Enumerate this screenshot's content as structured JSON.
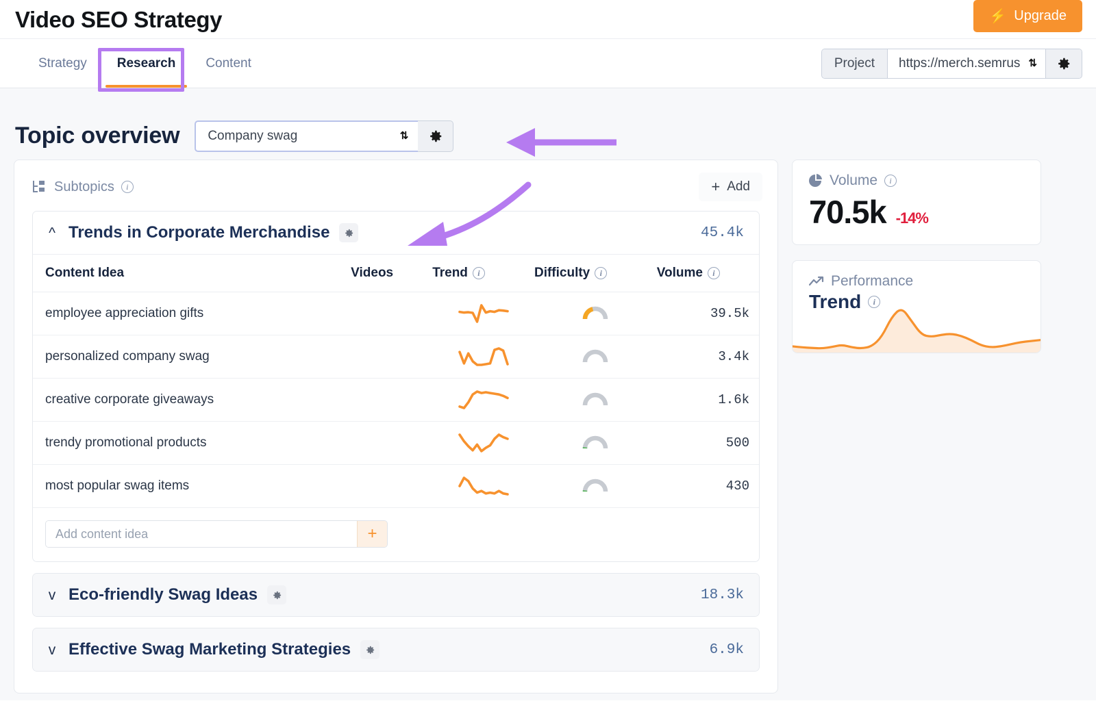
{
  "header": {
    "title": "Video SEO Strategy",
    "upgrade_label": "Upgrade",
    "bolt_icon": "lightning-bolt-icon"
  },
  "tabs": [
    {
      "label": "Strategy",
      "active": false
    },
    {
      "label": "Research",
      "active": true
    },
    {
      "label": "Content",
      "active": false
    }
  ],
  "project": {
    "label": "Project",
    "value": "https://merch.semrus",
    "gear_icon": "gear-icon"
  },
  "overview": {
    "title": "Topic overview",
    "topic_value": "Company swag",
    "gear_icon": "gear-icon"
  },
  "subtopics_panel": {
    "label": "Subtopics",
    "info_icon": "info-icon",
    "tree_icon": "hierarchy-icon",
    "add_label": "Add",
    "add_icon": "plus-icon"
  },
  "table": {
    "columns": [
      "Content Idea",
      "Videos",
      "Trend",
      "Difficulty",
      "Volume"
    ],
    "rows": [
      {
        "idea": "employee appreciation gifts",
        "videos": "",
        "volume": "39.5k",
        "difficulty": 42,
        "difficulty_color": "#f5a623",
        "trend": [
          50,
          48,
          49,
          47,
          20,
          70,
          48,
          52,
          50,
          55,
          54,
          52
        ]
      },
      {
        "idea": "personalized company swag",
        "videos": "",
        "volume": "3.4k",
        "difficulty": 2,
        "difficulty_color": "#c7cbd1",
        "trend": [
          62,
          30,
          58,
          36,
          26,
          26,
          28,
          30,
          68,
          72,
          66,
          28
        ]
      },
      {
        "idea": "creative corporate giveaways",
        "videos": "",
        "volume": "1.6k",
        "difficulty": 2,
        "difficulty_color": "#c7cbd1",
        "trend": [
          28,
          24,
          40,
          62,
          70,
          66,
          68,
          66,
          64,
          62,
          58,
          52
        ]
      },
      {
        "idea": "trendy promotional products",
        "videos": "",
        "volume": "500",
        "difficulty": 3,
        "difficulty_color": "#4caf50",
        "trend": [
          62,
          46,
          34,
          24,
          38,
          22,
          30,
          36,
          52,
          62,
          56,
          52
        ]
      },
      {
        "idea": "most popular swag items",
        "videos": "",
        "volume": "430",
        "difficulty": 3,
        "difficulty_color": "#4caf50",
        "trend": [
          46,
          66,
          58,
          40,
          30,
          34,
          28,
          30,
          28,
          34,
          28,
          26
        ]
      }
    ],
    "add_idea_placeholder": "Add content idea",
    "add_idea_value": "",
    "add_idea_button": "+"
  },
  "subtopic_groups": [
    {
      "title": "Trends in Corporate Merchandise",
      "volume": "45.4k",
      "expanded": true,
      "chevron": "^",
      "gear_icon": "gear-icon"
    },
    {
      "title": "Eco-friendly Swag Ideas",
      "volume": "18.3k",
      "expanded": false,
      "chevron": "v",
      "gear_icon": "gear-icon"
    },
    {
      "title": "Effective Swag Marketing Strategies",
      "volume": "6.9k",
      "expanded": false,
      "chevron": "v",
      "gear_icon": "gear-icon"
    }
  ],
  "sidebar": {
    "volume_card": {
      "label": "Volume",
      "icon": "pie-chart-icon",
      "info_icon": "info-icon",
      "value": "70.5k",
      "delta": "-14%",
      "delta_color": "#e01e3c"
    },
    "performance_card": {
      "label": "Performance",
      "icon": "trending-up-icon",
      "title": "Trend",
      "info_icon": "info-icon",
      "line_color": "#f7922e",
      "series": [
        22,
        20,
        19,
        18,
        21,
        25,
        20,
        18,
        22,
        40,
        78,
        96,
        70,
        44,
        40,
        44,
        46,
        42,
        34,
        24,
        20,
        22,
        26,
        30,
        32,
        34
      ]
    }
  },
  "annotations": {
    "color": "#b57bf0",
    "items": [
      {
        "name": "arrow-to-topic-selector",
        "type": "straight-arrow-left"
      },
      {
        "name": "arrow-to-subtopic-settings",
        "type": "curved-arrow-left"
      },
      {
        "name": "research-tab-highlight",
        "type": "rectangle"
      }
    ]
  }
}
